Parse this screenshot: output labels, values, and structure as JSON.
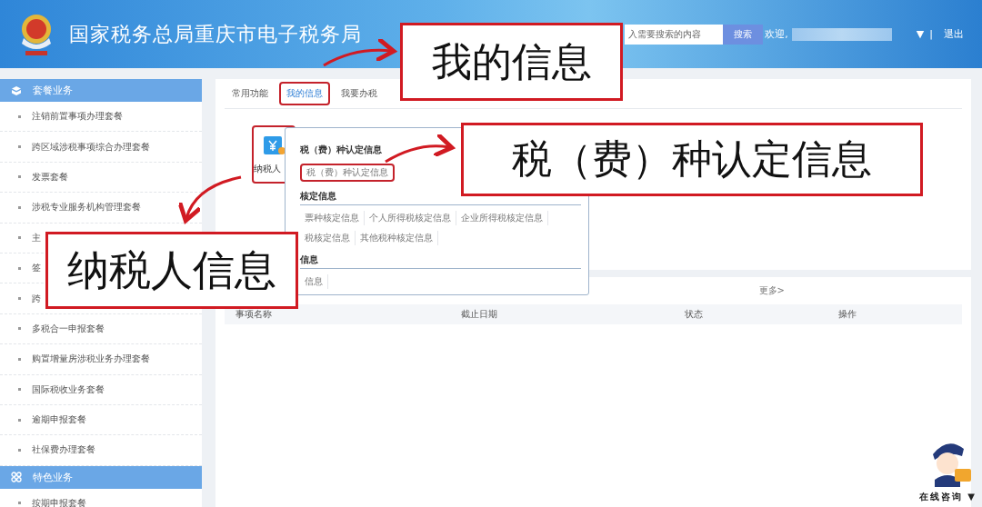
{
  "header": {
    "title": "国家税务总局重庆市电子税务局",
    "search": {
      "placeholder": "入需要搜索的内容",
      "button": "搜索"
    },
    "welcome": "欢迎,",
    "user_caret": "▼",
    "separator": "|",
    "logout": "退出"
  },
  "sidebar": {
    "sections": [
      {
        "title": "套餐业务",
        "kind": "cube",
        "items": [
          {
            "label": "注销前置事项办理套餐"
          },
          {
            "label": "跨区域涉税事项综合办理套餐"
          },
          {
            "label": "发票套餐"
          },
          {
            "label": "涉税专业服务机构管理套餐"
          },
          {
            "label": "主"
          },
          {
            "label": "签"
          },
          {
            "label": "跨"
          },
          {
            "label": "多税合一申报套餐"
          },
          {
            "label": "购置增量房涉税业务办理套餐"
          },
          {
            "label": "国际税收业务套餐"
          },
          {
            "label": "逾期申报套餐"
          },
          {
            "label": "社保费办理套餐"
          }
        ]
      },
      {
        "title": "特色业务",
        "kind": "grid",
        "items": [
          {
            "label": "按期申报套餐"
          }
        ]
      }
    ]
  },
  "tabs": [
    {
      "label": "常用功能",
      "selected": false,
      "highlighted": false
    },
    {
      "label": "我的信息",
      "selected": true,
      "highlighted": true
    },
    {
      "label": "我要办税",
      "selected": false,
      "highlighted": false
    }
  ],
  "tile": {
    "label": "纳税人",
    "highlighted": true
  },
  "popup": {
    "sections": [
      {
        "title": "税（费）种认定信息",
        "items": [
          {
            "label": "税（费）种认定信息",
            "highlighted": true
          }
        ]
      },
      {
        "title": "核定信息",
        "items": [
          {
            "label": "票种核定信息",
            "highlighted": false
          },
          {
            "label": "个人所得税核定信息",
            "highlighted": false
          },
          {
            "label": "企业所得税核定信息",
            "highlighted": false
          },
          {
            "label": "税核定信息",
            "highlighted": false
          },
          {
            "label": "其他税种核定信息",
            "highlighted": false
          }
        ]
      },
      {
        "title": "信息",
        "items": [
          {
            "label": "信息",
            "highlighted": false
          }
        ]
      }
    ]
  },
  "table": {
    "more": "更多>",
    "columns": [
      "事项名称",
      "截止日期",
      "状态",
      "操作"
    ]
  },
  "assistant": {
    "label": "在线咨询",
    "caret": "▼"
  },
  "callouts": [
    {
      "text": "我的信息"
    },
    {
      "text": "税（费）种认定信息"
    },
    {
      "text": "纳税人信息"
    }
  ]
}
